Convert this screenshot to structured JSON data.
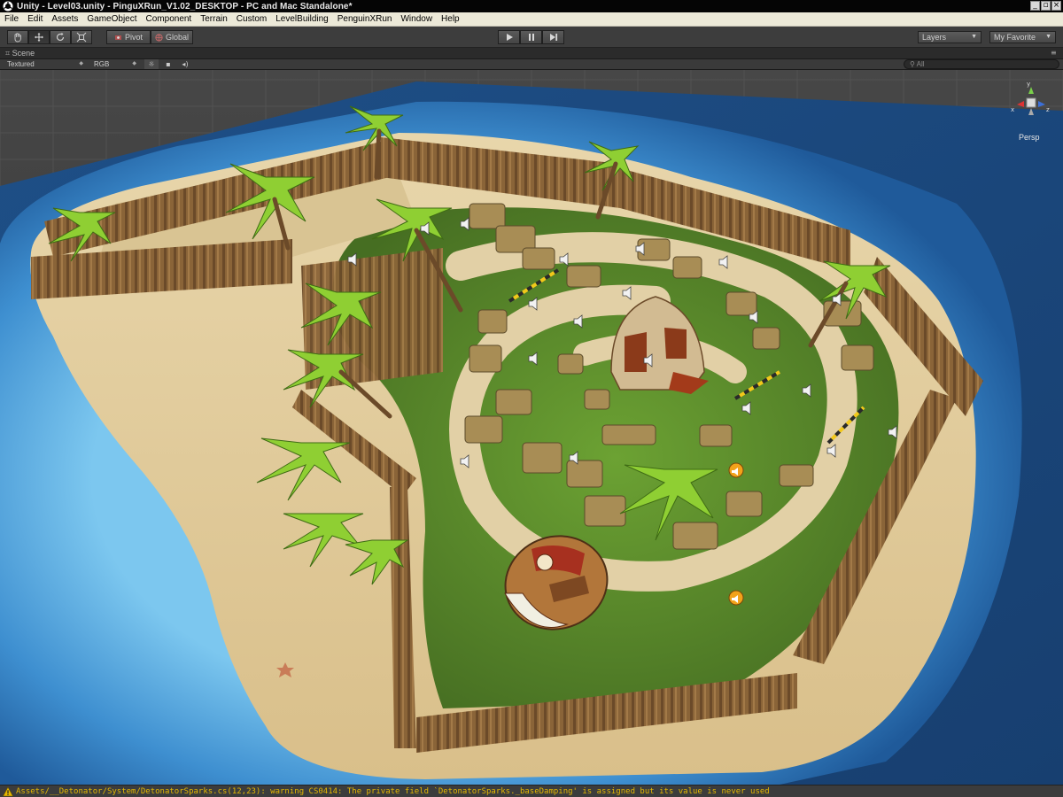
{
  "window": {
    "title": "Unity - Level03.unity - PinguXRun_V1.02_DESKTOP - PC and Mac Standalone*",
    "buttons": [
      "minimize-icon",
      "maximize-icon",
      "close-icon"
    ]
  },
  "menu": {
    "items": [
      {
        "label": "File"
      },
      {
        "label": "Edit"
      },
      {
        "label": "Assets"
      },
      {
        "label": "GameObject"
      },
      {
        "label": "Component"
      },
      {
        "label": "Terrain"
      },
      {
        "label": "Custom"
      },
      {
        "label": "LevelBuilding"
      },
      {
        "label": "PenguinXRun"
      },
      {
        "label": "Window"
      },
      {
        "label": "Help"
      }
    ]
  },
  "toolbar": {
    "tools": [
      "hand-tool-icon",
      "move-tool-icon",
      "rotate-tool-icon",
      "scale-tool-icon"
    ],
    "active_tool": "move",
    "pivot_label": "Pivot",
    "global_label": "Global",
    "play_controls": [
      "play-icon",
      "pause-icon",
      "step-icon"
    ],
    "layers_label": "Layers",
    "layout_label": "My Favorite"
  },
  "scene_view": {
    "tab_label": "Scene",
    "render_mode": "Textured",
    "color_mode": "RGB",
    "search_placeholder": "All",
    "camera_mode": "Persp",
    "gizmo_axes": {
      "y": "y",
      "x": "x",
      "z": "z"
    }
  },
  "colors": {
    "toolbar_bg": "#3d3d3d",
    "menu_bg": "#ece9d8",
    "sea": "#1f5a9a",
    "shallow": "#62b8ea",
    "sand": "#e4cfa2",
    "grass": "#5f8f2c",
    "warning": "#e6b800"
  },
  "status": {
    "message": "Assets/__Detonator/System/DetonatorSparks.cs(12,23): warning CS0414: The private field `DetonatorSparks._baseDamping' is assigned but its value is never used"
  }
}
